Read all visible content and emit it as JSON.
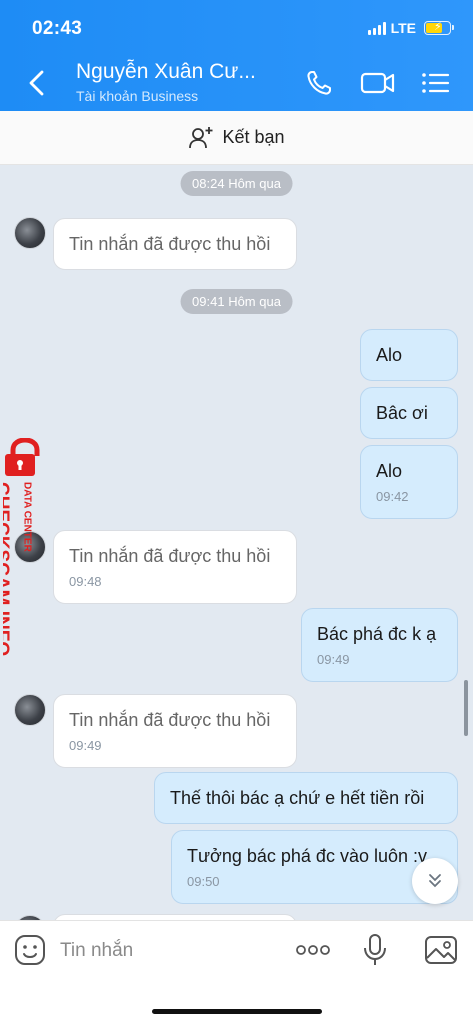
{
  "status_bar": {
    "time": "02:43",
    "network": "LTE"
  },
  "header": {
    "contact_name": "Nguyễn Xuân Cư...",
    "subtitle": "Tài khoản Business"
  },
  "friend_bar": {
    "label": "Kết bạn"
  },
  "messages": [
    {
      "type": "time",
      "text": "08:24 Hôm qua"
    },
    {
      "type": "in",
      "text": "Tin nhắn đã được thu hồi",
      "time": ""
    },
    {
      "type": "time",
      "text": "09:41 Hôm qua"
    },
    {
      "type": "out",
      "text": "Alo",
      "time": ""
    },
    {
      "type": "out",
      "text": "Bâc ơi",
      "time": ""
    },
    {
      "type": "out",
      "text": "Alo",
      "time": "09:42"
    },
    {
      "type": "in",
      "text": "Tin nhắn đã được thu hồi",
      "time": "09:48"
    },
    {
      "type": "out",
      "text": "Bác phá đc k ạ",
      "time": "09:49"
    },
    {
      "type": "in",
      "text": "Tin nhắn đã được thu hồi",
      "time": "09:49"
    },
    {
      "type": "out",
      "text": "Thế thôi bác ạ chứ e hết tiền rồi",
      "time": ""
    },
    {
      "type": "out",
      "text": "Tưởng bác phá đc vào luôn :v",
      "time": "09:50"
    }
  ],
  "watermark": {
    "line1": "CHECKSCAM.INFO",
    "line2": "DATA CENTER"
  },
  "input": {
    "placeholder": "Tin nhắn"
  },
  "icons": {
    "back": "chevron-left-icon",
    "call": "phone-icon",
    "video": "video-icon",
    "menu": "list-menu-icon",
    "add_friend": "add-user-icon",
    "emoji": "emoji-icon",
    "more": "more-dots-icon",
    "mic": "microphone-icon",
    "image": "image-icon",
    "scroll_down": "double-chevron-down-icon"
  },
  "colors": {
    "header": "#1e8cf5",
    "chat_bg": "#e2e9f1",
    "out_bubble": "#d5ecfd",
    "in_bubble": "#ffffff",
    "watermark": "#e02020"
  }
}
